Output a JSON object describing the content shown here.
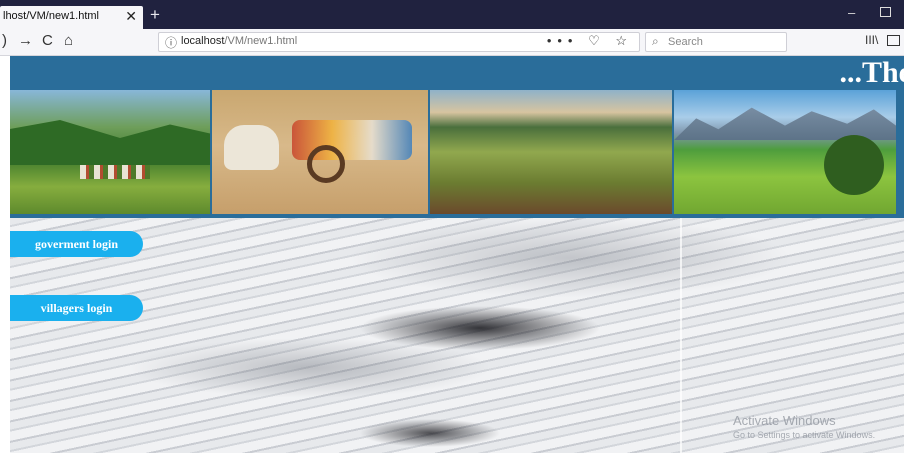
{
  "browser": {
    "tab_title": "lhost/VM/new1.html",
    "tab_close": "✕",
    "new_tab": "+",
    "back_glyph": "→",
    "reload_glyph": "C",
    "home_glyph": "⌂",
    "url_host": "localhost",
    "url_path": "/VM/new1.html",
    "url_actions": "••• ♡ ☆",
    "search_placeholder": "Search",
    "minimize_glyph": "–",
    "library_glyph": "III\\"
  },
  "page": {
    "heading": "...The",
    "buttons": {
      "government_login": "goverment login",
      "villagers_login": "villagers login"
    },
    "photos": [
      "mountain-village",
      "bullock-cart",
      "valley-fields",
      "alpine-meadow"
    ]
  },
  "watermark": {
    "line1": "Activate Windows",
    "line2": "Go to Settings to activate Windows."
  }
}
